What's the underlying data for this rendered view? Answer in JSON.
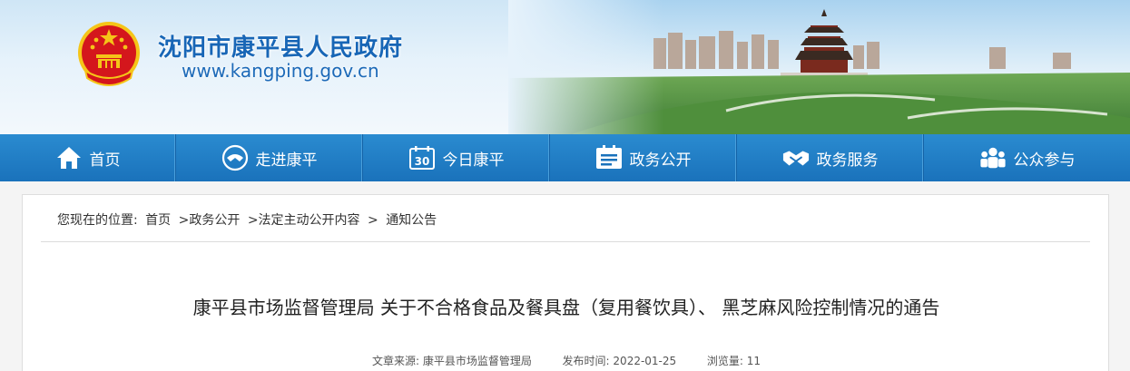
{
  "header": {
    "site_title": "沈阳市康平县人民政府",
    "site_url": "www.kangping.gov.cn"
  },
  "nav": {
    "items": [
      {
        "label": "首页",
        "icon": "home-icon"
      },
      {
        "label": "走进康平",
        "icon": "handshake-circle-icon"
      },
      {
        "label": "今日康平",
        "icon": "calendar-30-icon"
      },
      {
        "label": "政务公开",
        "icon": "document-list-icon"
      },
      {
        "label": "政务服务",
        "icon": "handshake-icon"
      },
      {
        "label": "公众参与",
        "icon": "people-group-icon"
      }
    ]
  },
  "breadcrumb": {
    "prefix": "您现在的位置:",
    "items": [
      "首页",
      ">政务公开",
      ">法定主动公开内容",
      ">",
      "通知公告"
    ]
  },
  "article": {
    "title": "康平县市场监督管理局 关于不合格食品及餐具盘（复用餐饮具）、 黑芝麻风险控制情况的通告",
    "source_label": "文章来源:",
    "source": "康平县市场监督管理局",
    "date_label": "发布时间:",
    "date": "2022-01-25",
    "views_label": "浏览量:",
    "views": "11"
  },
  "colors": {
    "nav_bg": "#1a72bb",
    "title_blue": "#1866b6",
    "emblem_red": "#d4161c",
    "emblem_gold": "#f5c518"
  }
}
